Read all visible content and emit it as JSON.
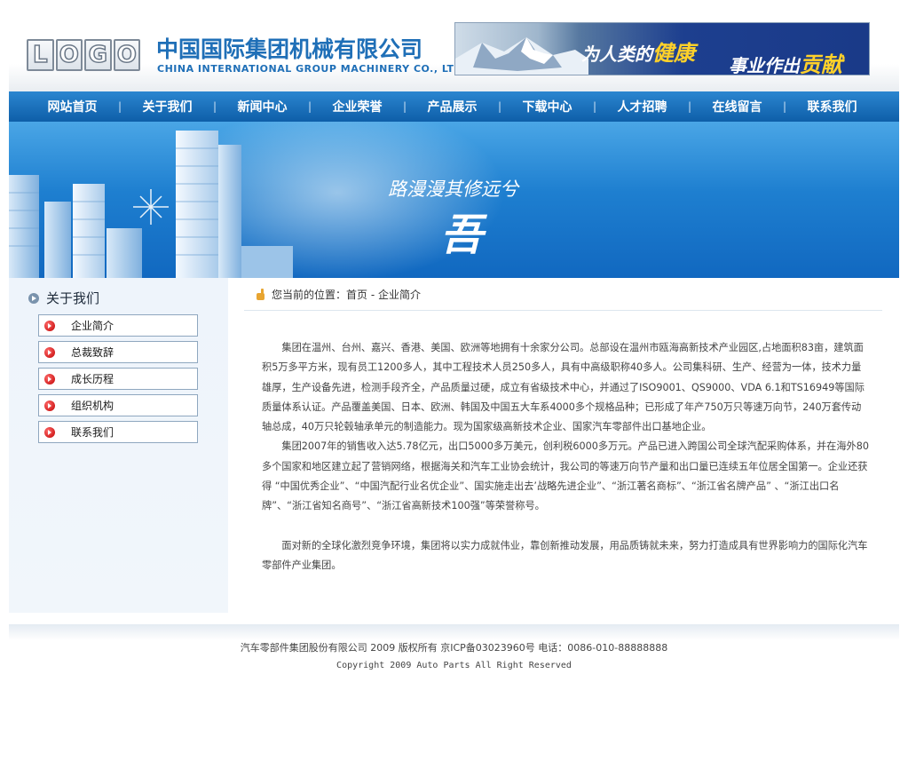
{
  "header": {
    "logo_letters": [
      "L",
      "O",
      "G",
      "O"
    ],
    "company_cn": "中国国际集团机械有限公司",
    "company_en": "CHINA INTERNATIONAL GROUP MACHINERY CO., LTD.",
    "banner": {
      "slogan_a_prefix": "为人类的",
      "slogan_a_highlight": "健康",
      "slogan_b_prefix": "事业作出",
      "slogan_b_highlight": "贡献"
    }
  },
  "nav": {
    "items": [
      "网站首页",
      "关于我们",
      "新闻中心",
      "企业荣誉",
      "产品展示",
      "下载中心",
      "人才招聘",
      "在线留言",
      "联系我们"
    ],
    "separator": "|"
  },
  "hero": {
    "title": "路漫漫其修远兮",
    "char": "吾"
  },
  "sidebar": {
    "title": "关于我们",
    "items": [
      "企业简介",
      "总裁致辞",
      "成长历程",
      "组织机构",
      "联系我们"
    ]
  },
  "breadcrumb": {
    "text": "您当前的位置：首页 - 企业简介"
  },
  "content": {
    "paragraphs": [
      "集团在温州、台州、嘉兴、香港、美国、欧洲等地拥有十余家分公司。总部设在温州市瓯海高新技术产业园区,占地面积83亩，建筑面积5万多平方米，现有员工1200多人，其中工程技术人员250多人，具有中高级职称40多人。公司集科研、生产、经营为一体，技术力量雄厚，生产设备先进，检测手段齐全，产品质量过硬，成立有省级技术中心，并通过了ISO9001、QS9000、VDA 6.1和TS16949等国际质量体系认证。产品覆盖美国、日本、欧洲、韩国及中国五大车系4000多个规格品种；已形成了年产750万只等速万向节，240万套传动轴总成，40万只轮毂轴承单元的制造能力。现为国家级高新技术企业、国家汽车零部件出口基地企业。",
      "集团2007年的销售收入达5.78亿元，出口5000多万美元，创利税6000多万元。产品已进入跨国公司全球汽配采购体系，并在海外80多个国家和地区建立起了营销网络，根据海关和汽车工业协会统计，我公司的等速万向节产量和出口量已连续五年位居全国第一。企业还获得 “中国优秀企业”、“中国汽配行业名优企业”、国实施走出去’战略先进企业”、“浙江著名商标”、“浙江省名牌产品” 、“浙江出口名牌”、“浙江省知名商号”、“浙江省高新技术100强”等荣誉称号。",
      "面对新的全球化激烈竞争环境，集团将以实力成就伟业，靠创新推动发展，用品质铸就未来，努力打造成具有世界影响力的国际化汽车零部件产业集团。"
    ]
  },
  "footer": {
    "line1": "汽车零部件集团股份有限公司 2009 版权所有 京ICP备03023960号 电话：0086-010-88888888",
    "line2": "Copyright 2009 Auto Parts All Right Reserved"
  },
  "colors": {
    "brand_blue": "#1f6fb7",
    "nav_blue": "#0e5ea8",
    "bullet_red": "#c00000"
  }
}
